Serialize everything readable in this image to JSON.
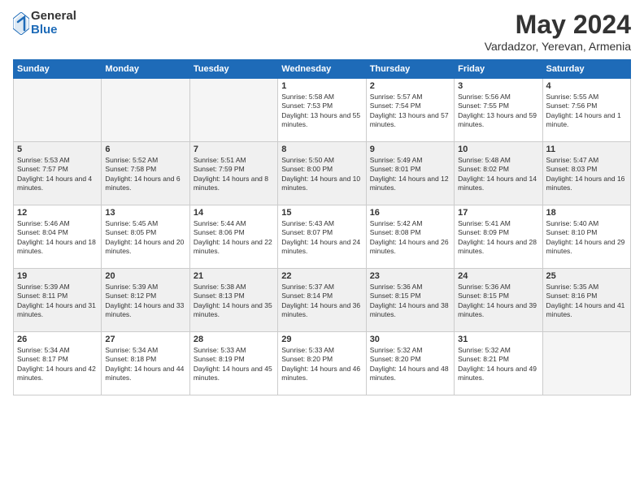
{
  "logo": {
    "general": "General",
    "blue": "Blue"
  },
  "title": "May 2024",
  "location": "Vardadzor, Yerevan, Armenia",
  "days_of_week": [
    "Sunday",
    "Monday",
    "Tuesday",
    "Wednesday",
    "Thursday",
    "Friday",
    "Saturday"
  ],
  "weeks": [
    [
      {
        "day": "",
        "empty": true
      },
      {
        "day": "",
        "empty": true
      },
      {
        "day": "",
        "empty": true
      },
      {
        "day": "1",
        "sunrise": "5:58 AM",
        "sunset": "7:53 PM",
        "daylight": "13 hours and 55 minutes."
      },
      {
        "day": "2",
        "sunrise": "5:57 AM",
        "sunset": "7:54 PM",
        "daylight": "13 hours and 57 minutes."
      },
      {
        "day": "3",
        "sunrise": "5:56 AM",
        "sunset": "7:55 PM",
        "daylight": "13 hours and 59 minutes."
      },
      {
        "day": "4",
        "sunrise": "5:55 AM",
        "sunset": "7:56 PM",
        "daylight": "14 hours and 1 minute."
      }
    ],
    [
      {
        "day": "5",
        "sunrise": "5:53 AM",
        "sunset": "7:57 PM",
        "daylight": "14 hours and 4 minutes."
      },
      {
        "day": "6",
        "sunrise": "5:52 AM",
        "sunset": "7:58 PM",
        "daylight": "14 hours and 6 minutes."
      },
      {
        "day": "7",
        "sunrise": "5:51 AM",
        "sunset": "7:59 PM",
        "daylight": "14 hours and 8 minutes."
      },
      {
        "day": "8",
        "sunrise": "5:50 AM",
        "sunset": "8:00 PM",
        "daylight": "14 hours and 10 minutes."
      },
      {
        "day": "9",
        "sunrise": "5:49 AM",
        "sunset": "8:01 PM",
        "daylight": "14 hours and 12 minutes."
      },
      {
        "day": "10",
        "sunrise": "5:48 AM",
        "sunset": "8:02 PM",
        "daylight": "14 hours and 14 minutes."
      },
      {
        "day": "11",
        "sunrise": "5:47 AM",
        "sunset": "8:03 PM",
        "daylight": "14 hours and 16 minutes."
      }
    ],
    [
      {
        "day": "12",
        "sunrise": "5:46 AM",
        "sunset": "8:04 PM",
        "daylight": "14 hours and 18 minutes."
      },
      {
        "day": "13",
        "sunrise": "5:45 AM",
        "sunset": "8:05 PM",
        "daylight": "14 hours and 20 minutes."
      },
      {
        "day": "14",
        "sunrise": "5:44 AM",
        "sunset": "8:06 PM",
        "daylight": "14 hours and 22 minutes."
      },
      {
        "day": "15",
        "sunrise": "5:43 AM",
        "sunset": "8:07 PM",
        "daylight": "14 hours and 24 minutes."
      },
      {
        "day": "16",
        "sunrise": "5:42 AM",
        "sunset": "8:08 PM",
        "daylight": "14 hours and 26 minutes."
      },
      {
        "day": "17",
        "sunrise": "5:41 AM",
        "sunset": "8:09 PM",
        "daylight": "14 hours and 28 minutes."
      },
      {
        "day": "18",
        "sunrise": "5:40 AM",
        "sunset": "8:10 PM",
        "daylight": "14 hours and 29 minutes."
      }
    ],
    [
      {
        "day": "19",
        "sunrise": "5:39 AM",
        "sunset": "8:11 PM",
        "daylight": "14 hours and 31 minutes."
      },
      {
        "day": "20",
        "sunrise": "5:39 AM",
        "sunset": "8:12 PM",
        "daylight": "14 hours and 33 minutes."
      },
      {
        "day": "21",
        "sunrise": "5:38 AM",
        "sunset": "8:13 PM",
        "daylight": "14 hours and 35 minutes."
      },
      {
        "day": "22",
        "sunrise": "5:37 AM",
        "sunset": "8:14 PM",
        "daylight": "14 hours and 36 minutes."
      },
      {
        "day": "23",
        "sunrise": "5:36 AM",
        "sunset": "8:15 PM",
        "daylight": "14 hours and 38 minutes."
      },
      {
        "day": "24",
        "sunrise": "5:36 AM",
        "sunset": "8:15 PM",
        "daylight": "14 hours and 39 minutes."
      },
      {
        "day": "25",
        "sunrise": "5:35 AM",
        "sunset": "8:16 PM",
        "daylight": "14 hours and 41 minutes."
      }
    ],
    [
      {
        "day": "26",
        "sunrise": "5:34 AM",
        "sunset": "8:17 PM",
        "daylight": "14 hours and 42 minutes."
      },
      {
        "day": "27",
        "sunrise": "5:34 AM",
        "sunset": "8:18 PM",
        "daylight": "14 hours and 44 minutes."
      },
      {
        "day": "28",
        "sunrise": "5:33 AM",
        "sunset": "8:19 PM",
        "daylight": "14 hours and 45 minutes."
      },
      {
        "day": "29",
        "sunrise": "5:33 AM",
        "sunset": "8:20 PM",
        "daylight": "14 hours and 46 minutes."
      },
      {
        "day": "30",
        "sunrise": "5:32 AM",
        "sunset": "8:20 PM",
        "daylight": "14 hours and 48 minutes."
      },
      {
        "day": "31",
        "sunrise": "5:32 AM",
        "sunset": "8:21 PM",
        "daylight": "14 hours and 49 minutes."
      },
      {
        "day": "",
        "empty": true
      }
    ]
  ]
}
